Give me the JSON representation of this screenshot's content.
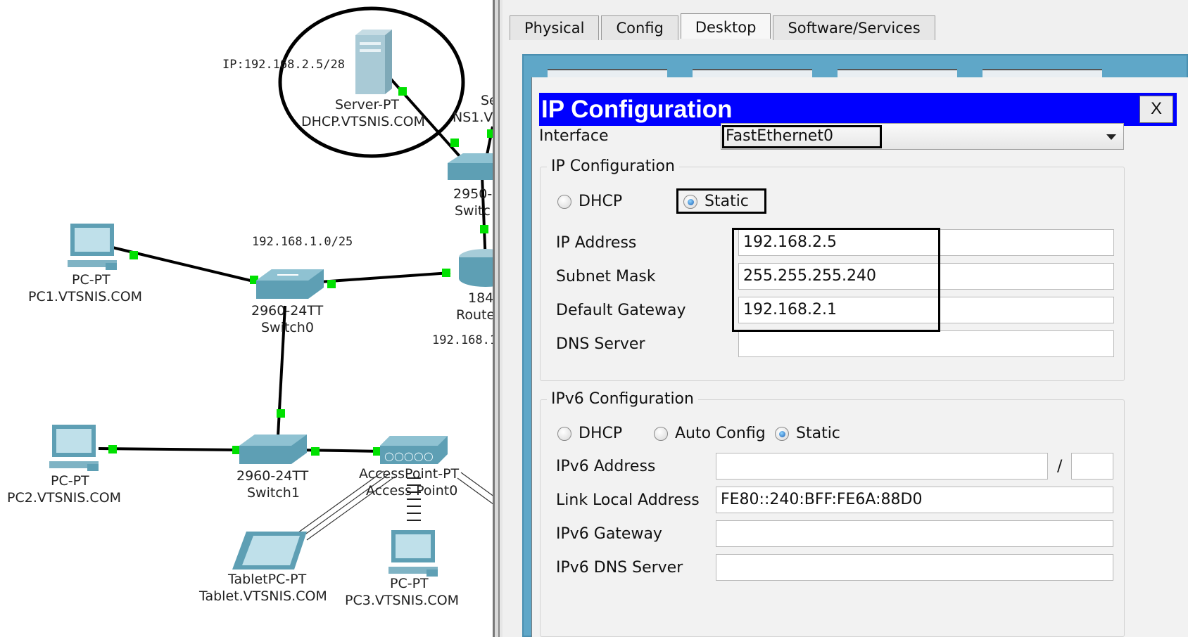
{
  "topology": {
    "server": {
      "ip_note": "IP:192.168.2.5/28",
      "type": "Server-PT",
      "name": "DHCP.VTSNIS.COM"
    },
    "pc1": {
      "type": "PC-PT",
      "name": "PC1.VTSNIS.COM"
    },
    "pc2": {
      "type": "PC-PT",
      "name": "PC2.VTSNIS.COM"
    },
    "pc3": {
      "type": "PC-PT",
      "name": "PC3.VTSNIS.COM"
    },
    "switch0": {
      "model": "2960-24TT",
      "name": "Switch0"
    },
    "switch1": {
      "model": "2960-24TT",
      "name": "Switch1"
    },
    "switch_top": {
      "model": "2950-",
      "name": "Switc"
    },
    "router": {
      "model": "184",
      "name": "Route"
    },
    "ap": {
      "type": "AccessPoint-PT",
      "name": "Access Point0"
    },
    "tablet": {
      "type": "TabletPC-PT",
      "name": "Tablet.VTSNIS.COM"
    },
    "dns_partial": {
      "type": "Se",
      "name": "NS1.V"
    },
    "net_labels": {
      "lan1": "192.168.1.0/25",
      "lan_partial": "192.168.1"
    },
    "colors": {
      "link": "#000000",
      "port_up": "#00e000",
      "device": "#3f8fa8"
    }
  },
  "window": {
    "tabs": [
      {
        "label": "Physical",
        "active": false
      },
      {
        "label": "Config",
        "active": false
      },
      {
        "label": "Desktop",
        "active": true
      },
      {
        "label": "Software/Services",
        "active": false
      }
    ]
  },
  "dialog": {
    "title": "IP Configuration",
    "close_label": "X",
    "interface_label": "Interface",
    "interface_value": "FastEthernet0",
    "ipv4": {
      "group_title": "IP Configuration",
      "dhcp_label": "DHCP",
      "static_label": "Static",
      "mode": "Static",
      "ip_label": "IP Address",
      "ip_value": "192.168.2.5",
      "mask_label": "Subnet Mask",
      "mask_value": "255.255.255.240",
      "gw_label": "Default Gateway",
      "gw_value": "192.168.2.1",
      "dns_label": "DNS Server",
      "dns_value": ""
    },
    "ipv6": {
      "group_title": "IPv6 Configuration",
      "dhcp_label": "DHCP",
      "auto_label": "Auto Config",
      "static_label": "Static",
      "mode": "Static",
      "addr_label": "IPv6 Address",
      "addr_value": "",
      "slash": "/",
      "prefix_value": "",
      "link_local_label": "Link Local Address",
      "link_local_value": "FE80::240:BFF:FE6A:88D0",
      "gw_label": "IPv6 Gateway",
      "gw_value": "",
      "dns_label": "IPv6 DNS Server",
      "dns_value": ""
    }
  }
}
